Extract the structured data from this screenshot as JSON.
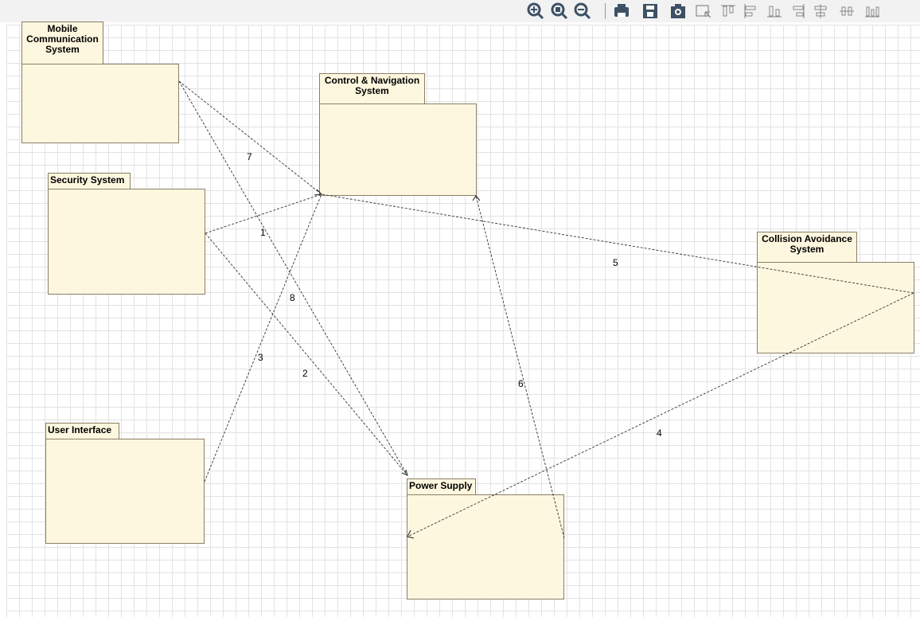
{
  "toolbar": {
    "icons": [
      "zoom-in-icon",
      "zoom-fit-icon",
      "zoom-out-icon",
      "print-icon",
      "save-icon",
      "screenshot-icon",
      "select-region-icon",
      "align-top-icon",
      "align-left-icon",
      "align-bottom-icon",
      "align-right-icon",
      "align-center-horizontal-icon",
      "distribute-horizontal-icon",
      "distribute-vertical-icon"
    ]
  },
  "diagram": {
    "packages": {
      "mobile": "Mobile Communication System",
      "control": "Control & Navigation System",
      "security": "Security System",
      "collision": "Collision Avoidance System",
      "user": "User Interface",
      "power": "Power Supply"
    },
    "edges": [
      {
        "label": "1",
        "from": "Security System",
        "to": "Control & Navigation System"
      },
      {
        "label": "2",
        "from": "Security System",
        "to": "Power Supply"
      },
      {
        "label": "3",
        "from": "User Interface",
        "to": "Control & Navigation System"
      },
      {
        "label": "4",
        "from": "Collision Avoidance System",
        "to": "Power Supply"
      },
      {
        "label": "5",
        "from": "Collision Avoidance System",
        "to": "Control & Navigation System"
      },
      {
        "label": "6",
        "from": "Power Supply",
        "to": "Control & Navigation System"
      },
      {
        "label": "7",
        "from": "Mobile Communication System",
        "to": "Control & Navigation System"
      },
      {
        "label": "8",
        "from": "Mobile Communication System",
        "to": "Power Supply"
      }
    ],
    "colors": {
      "package_fill": "#fef7df",
      "package_border": "#8a7f66",
      "toolbar_icon": "#3d5166"
    }
  }
}
